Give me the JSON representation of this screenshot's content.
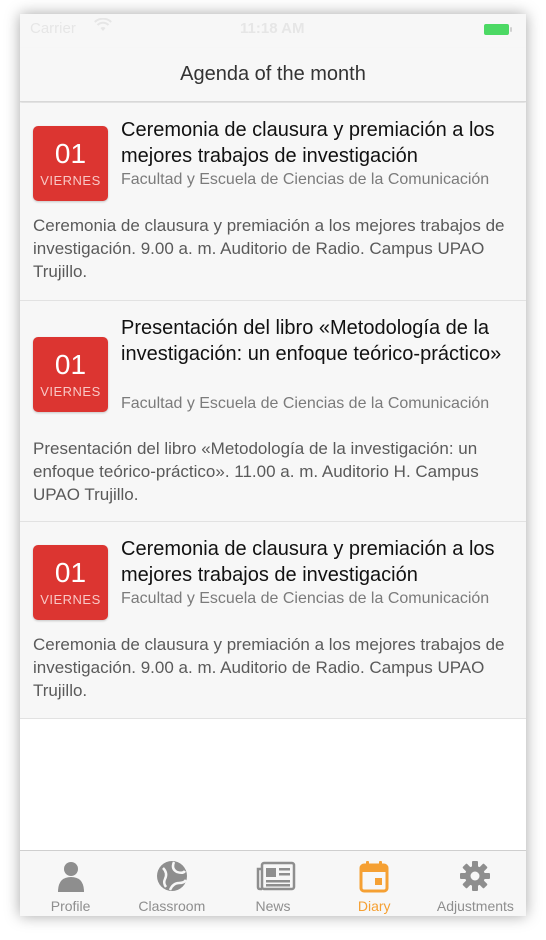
{
  "status_bar": {
    "carrier": "Carrier",
    "time": "11:18 AM"
  },
  "header": {
    "title": "Agenda of the month"
  },
  "events": [
    {
      "day": "01",
      "weekday": "VIERNES",
      "title": "Ceremonia de clausura y premiación a los mejores trabajos de investigación",
      "organizer": "Facultad y Escuela de Ciencias de la Comunicación",
      "description": "Ceremonia de clausura y premiación a los mejores trabajos de investigación. 9.00 a. m. Auditorio de Radio. Campus UPAO Trujillo."
    },
    {
      "day": "01",
      "weekday": "VIERNES",
      "title": "Presentación del libro «Metodología de la investigación: un enfoque teórico-práctico»",
      "organizer": "Facultad y Escuela de Ciencias de la Comunicación",
      "description": "Presentación del libro «Metodología de la investigación: un enfoque teórico-práctico». 11.00 a. m. Auditorio H. Campus UPAO Trujillo."
    },
    {
      "day": "01",
      "weekday": "VIERNES",
      "title": "Ceremonia de clausura y premiación a los mejores trabajos de investigación",
      "organizer": "Facultad y Escuela de Ciencias de la Comunicación",
      "description": "Ceremonia de clausura y premiación a los mejores trabajos de investigación. 9.00 a. m. Auditorio de Radio. Campus UPAO Trujillo."
    }
  ],
  "tabs": [
    {
      "label": "Profile",
      "icon": "person-icon",
      "active": false
    },
    {
      "label": "Classroom",
      "icon": "globe-icon",
      "active": false
    },
    {
      "label": "News",
      "icon": "newspaper-icon",
      "active": false
    },
    {
      "label": "Diary",
      "icon": "calendar-icon",
      "active": true
    },
    {
      "label": "Adjustments",
      "icon": "gear-icon",
      "active": false
    }
  ],
  "colors": {
    "accent": "#f5a033",
    "badge": "#dc3531",
    "battery": "#4cd964",
    "inactive_tab": "#8e8e8e"
  }
}
